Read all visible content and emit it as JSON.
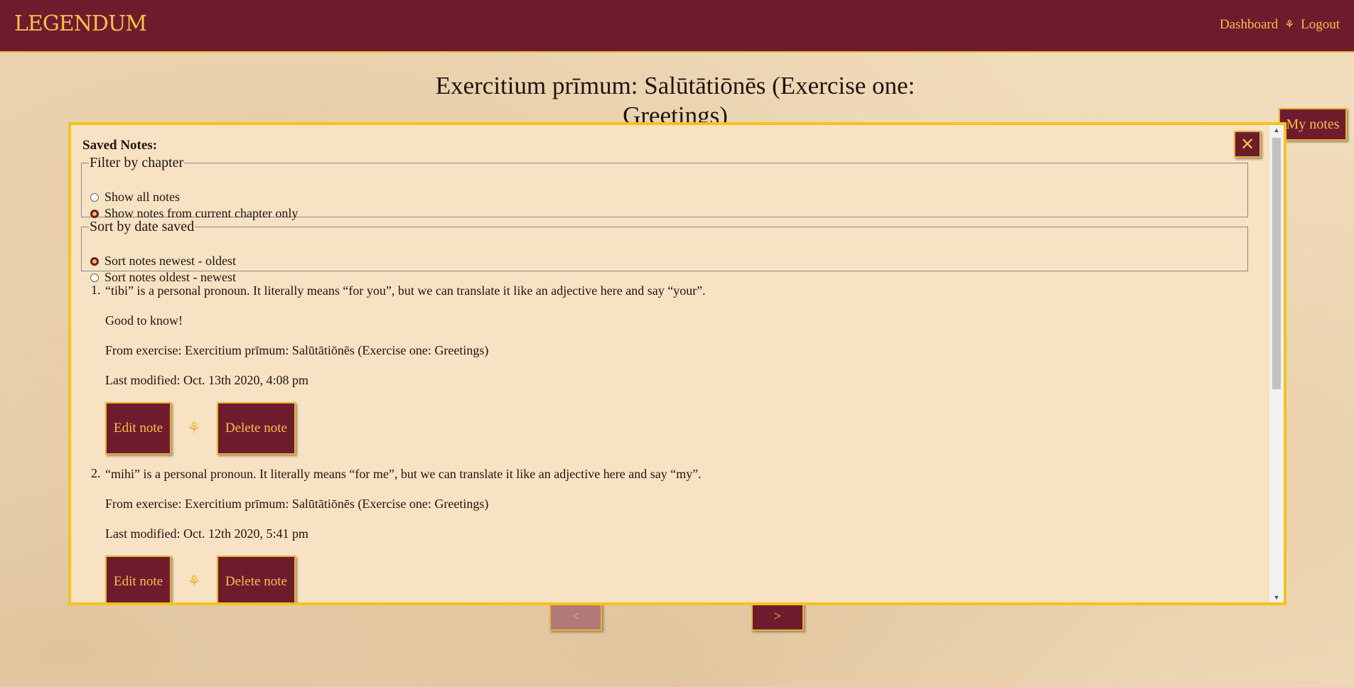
{
  "header": {
    "logo": "LEGENDUM",
    "nav_dashboard": "Dashboard",
    "nav_separator": "⚘",
    "nav_logout": "Logout"
  },
  "page": {
    "title": "Exercitium prīmum: Salūtātiōnēs (Exercise one: Greetings)",
    "my_notes": "My notes",
    "prev": "<",
    "next": ">"
  },
  "modal": {
    "close_icon": "✕",
    "heading": "Saved Notes:",
    "filter": {
      "legend": "Filter by chapter",
      "options": [
        "Show all notes",
        "Show notes from current chapter only"
      ],
      "selected": 1
    },
    "sort": {
      "legend": "Sort by date saved",
      "options": [
        "Sort notes newest - oldest",
        "Sort notes oldest - newest"
      ],
      "selected": 0
    },
    "notes": [
      {
        "num": "1.",
        "text": "“tibi” is a personal pronoun. It literally means “for you”, but we can translate it like an adjective here and say “your”.",
        "comment": "Good to know!",
        "from": "From exercise: Exercitium prīmum: Salūtātiōnēs (Exercise one: Greetings)",
        "modified": "Last modified: Oct. 13th 2020, 4:08 pm"
      },
      {
        "num": "2.",
        "text": "“mihi” is a personal pronoun. It literally means “for me”, but we can translate it like an adjective here and say “my”.",
        "from": "From exercise: Exercitium prīmum: Salūtātiōnēs (Exercise one: Greetings)",
        "modified": "Last modified: Oct. 12th 2020, 5:41 pm"
      }
    ],
    "edit_label": "Edit note",
    "delete_label": "Delete note",
    "separator_icon": "⚘"
  }
}
